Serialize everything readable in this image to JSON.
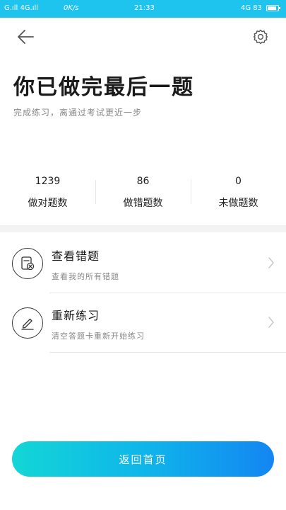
{
  "status_bar": {
    "signal": "G.ıll 4G.ıll",
    "speed": "0K/s",
    "time": "21:33",
    "right": "4G 83"
  },
  "page": {
    "title": "你已做完最后一题",
    "subtitle": "完成练习，离通过考试更近一步"
  },
  "stats": [
    {
      "value": "1239",
      "label": "做对题数"
    },
    {
      "value": "86",
      "label": "做错题数"
    },
    {
      "value": "0",
      "label": "未做题数"
    }
  ],
  "actions": [
    {
      "title": "查看错题",
      "desc": "查看我的所有错题",
      "icon": "wrong-answers-icon"
    },
    {
      "title": "重新练习",
      "desc": "清空答题卡重新开始练习",
      "icon": "pencil-icon"
    }
  ],
  "buttons": {
    "home": "返回首页"
  },
  "colors": {
    "status_bar": "#1fc4ee",
    "gradient_start": "#13d6d6",
    "gradient_end": "#1386f2"
  }
}
